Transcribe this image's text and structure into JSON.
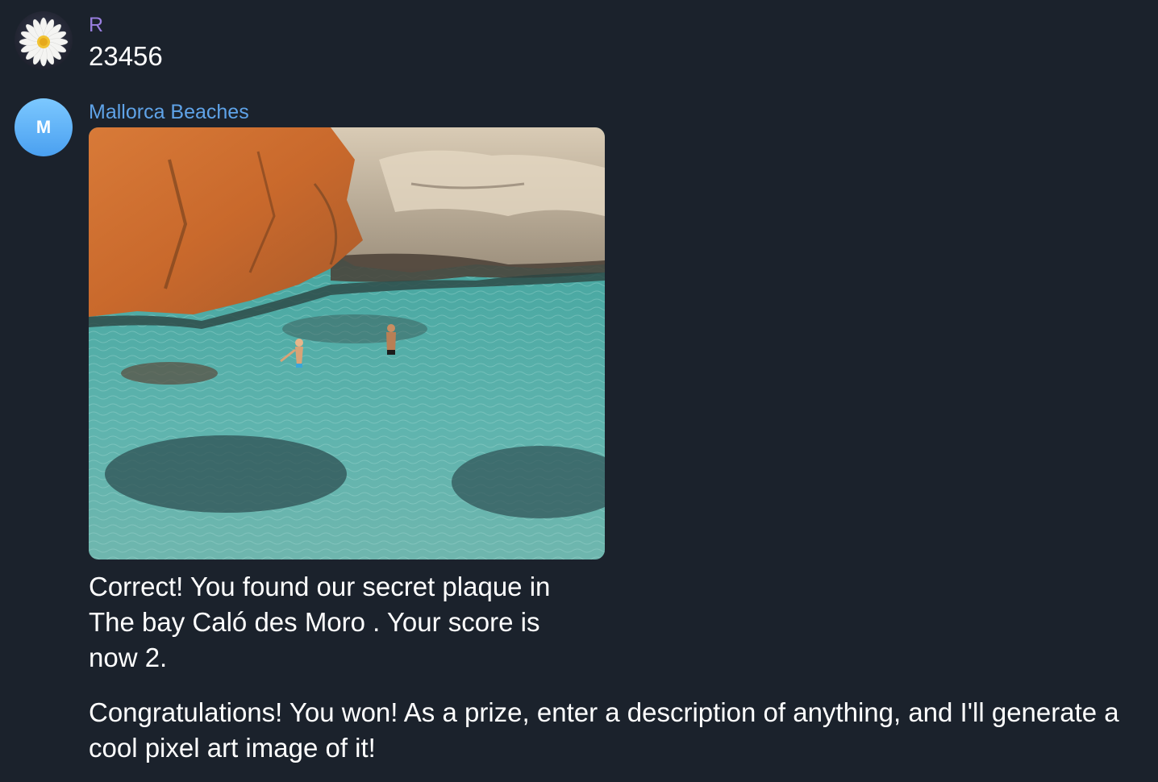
{
  "messages": [
    {
      "sender": "R",
      "avatar_icon": "daisy-flower-icon",
      "text": "23456"
    },
    {
      "sender": "Mallorca Beaches",
      "avatar_initial": "M",
      "photo_icon": "beach-cove-photo",
      "caption": "Correct! You found our secret plaque in The bay Caló des Moro . Your score is now 2.",
      "followup": "Congratulations! You won! As a prize, enter a description of anything, and I'll generate a cool pixel art image of it!"
    }
  ],
  "colors": {
    "background": "#1b222c",
    "sender_r": "#9a7fe0",
    "sender_m": "#5fa3e8",
    "avatar_m": "#6bb8fb"
  }
}
